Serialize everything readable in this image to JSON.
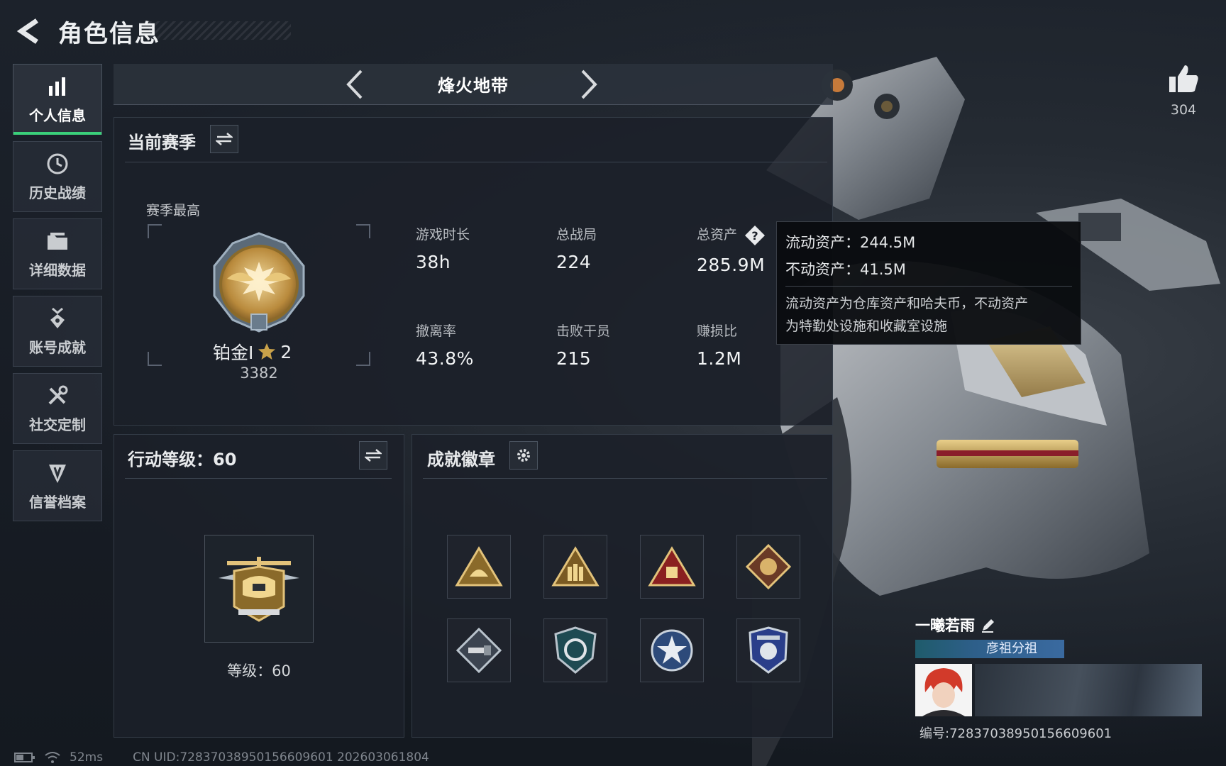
{
  "header": {
    "title": "角色信息"
  },
  "sidebar": {
    "items": [
      {
        "label": "个人信息",
        "icon": "bar-chart-icon",
        "active": true
      },
      {
        "label": "历史战绩",
        "icon": "history-icon",
        "active": false
      },
      {
        "label": "详细数据",
        "icon": "folder-icon",
        "active": false
      },
      {
        "label": "账号成就",
        "icon": "medal-icon",
        "active": false
      },
      {
        "label": "社交定制",
        "icon": "tools-icon",
        "active": false
      },
      {
        "label": "信誉档案",
        "icon": "reputation-icon",
        "active": false
      }
    ]
  },
  "mode_selector": {
    "current": "烽火地带"
  },
  "season": {
    "title": "当前赛季",
    "best_label": "赛季最高",
    "rank_name": "铂金I",
    "rank_stars": "2",
    "rank_points": "3382",
    "stats": [
      {
        "label": "游戏时长",
        "value": "38h"
      },
      {
        "label": "总战局",
        "value": "224"
      },
      {
        "label": "总资产",
        "value": "285.9M"
      },
      {
        "label": "撤离率",
        "value": "43.8%"
      },
      {
        "label": "击败干员",
        "value": "215"
      },
      {
        "label": "赚损比",
        "value": "1.2M"
      }
    ]
  },
  "assets_tooltip": {
    "liquid": "流动资产：244.5M",
    "fixed": "不动资产：41.5M",
    "desc_line1": "流动资产为仓库资产和哈夫币，不动资产",
    "desc_line2": "为特勤处设施和收藏室设施"
  },
  "action_level": {
    "title": "行动等级：60",
    "caption": "等级：60"
  },
  "badges": {
    "title": "成就徽章",
    "items": [
      {
        "icon": "triangle-helmet-badge-icon"
      },
      {
        "icon": "triangle-squad-badge-icon"
      },
      {
        "icon": "triangle-crate-badge-icon"
      },
      {
        "icon": "diamond-beast-badge-icon"
      },
      {
        "icon": "diamond-drone-badge-icon"
      },
      {
        "icon": "shield-cycle-badge-icon"
      },
      {
        "icon": "star-circle-badge-icon"
      },
      {
        "icon": "police-shield-badge-icon"
      }
    ]
  },
  "likes": {
    "count": "304"
  },
  "player": {
    "name": "一曦若雨",
    "tag": "彦祖分祖",
    "id_label": "编号:7283703895015660960​1"
  },
  "footer": {
    "ping": "52ms",
    "uid": "CN UID:7283703895015660960​1 202603061804"
  },
  "colors": {
    "accent_green": "#3ad07a",
    "gold": "#c9a24a",
    "panel_bg": "#1b2029"
  }
}
